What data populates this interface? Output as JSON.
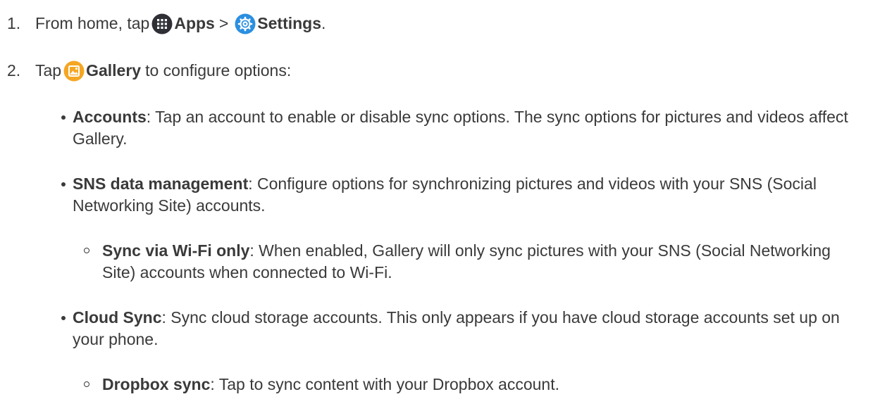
{
  "steps": [
    {
      "number": "1.",
      "prefix": "From home, tap",
      "apps_label": "Apps",
      "separator": ">",
      "settings_label": "Settings",
      "suffix": "."
    },
    {
      "number": "2.",
      "prefix": "Tap",
      "gallery_label": "Gallery",
      "suffix": "to configure options:"
    }
  ],
  "options": [
    {
      "term": "Accounts",
      "desc": ": Tap an account to enable or disable sync options. The sync options for pictures and videos affect Gallery."
    },
    {
      "term": "SNS data management",
      "desc": ": Configure options for synchronizing pictures and videos with your SNS (Social Networking Site) accounts.",
      "sub": {
        "term": "Sync via Wi-Fi only",
        "desc": ": When enabled, Gallery will only sync pictures with your SNS (Social Networking Site) accounts when connected to Wi-Fi."
      }
    },
    {
      "term": "Cloud Sync",
      "desc": ": Sync cloud storage accounts. This only appears if you have cloud storage accounts set up on your phone.",
      "sub": {
        "term": "Dropbox sync",
        "desc": ": Tap to sync content with your Dropbox account."
      }
    }
  ],
  "icons": {
    "apps": "apps-grid-icon",
    "settings": "settings-gear-icon",
    "gallery": "gallery-icon"
  },
  "colors": {
    "text": "#3a3a3a",
    "apps_icon_bg": "#2f2f36",
    "settings_icon_bg": "#2b8fe0",
    "gallery_icon_bg": "#f5a623"
  }
}
